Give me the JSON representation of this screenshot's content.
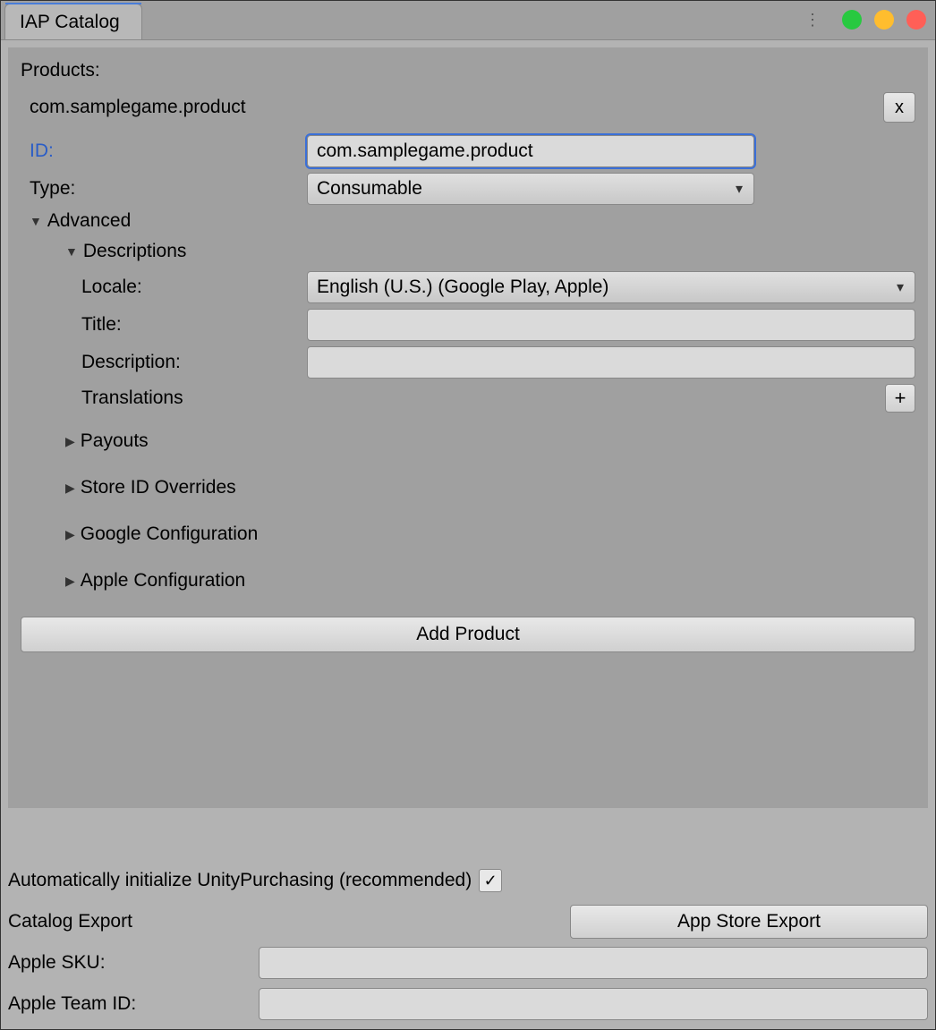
{
  "tab": {
    "title": "IAP Catalog"
  },
  "products": {
    "heading": "Products:",
    "item_name": "com.samplegame.product",
    "delete_btn": "x"
  },
  "fields": {
    "id_label": "ID:",
    "id_value": "com.samplegame.product",
    "type_label": "Type:",
    "type_value": "Consumable"
  },
  "advanced": {
    "label": "Advanced",
    "descriptions": {
      "label": "Descriptions",
      "locale_label": "Locale:",
      "locale_value": "English (U.S.) (Google Play, Apple)",
      "title_label": "Title:",
      "title_value": "",
      "description_label": "Description:",
      "description_value": "",
      "translations_label": "Translations",
      "add_btn": "+"
    },
    "payouts": "Payouts",
    "store_overrides": "Store ID Overrides",
    "google_config": "Google Configuration",
    "apple_config": "Apple Configuration"
  },
  "add_product_btn": "Add Product",
  "footer": {
    "auto_init_label": "Automatically initialize UnityPurchasing (recommended)",
    "auto_init_checked": true,
    "catalog_export_label": "Catalog Export",
    "export_btn": "App Store Export",
    "apple_sku_label": "Apple SKU:",
    "apple_sku_value": "",
    "apple_team_label": "Apple Team ID:",
    "apple_team_value": ""
  }
}
